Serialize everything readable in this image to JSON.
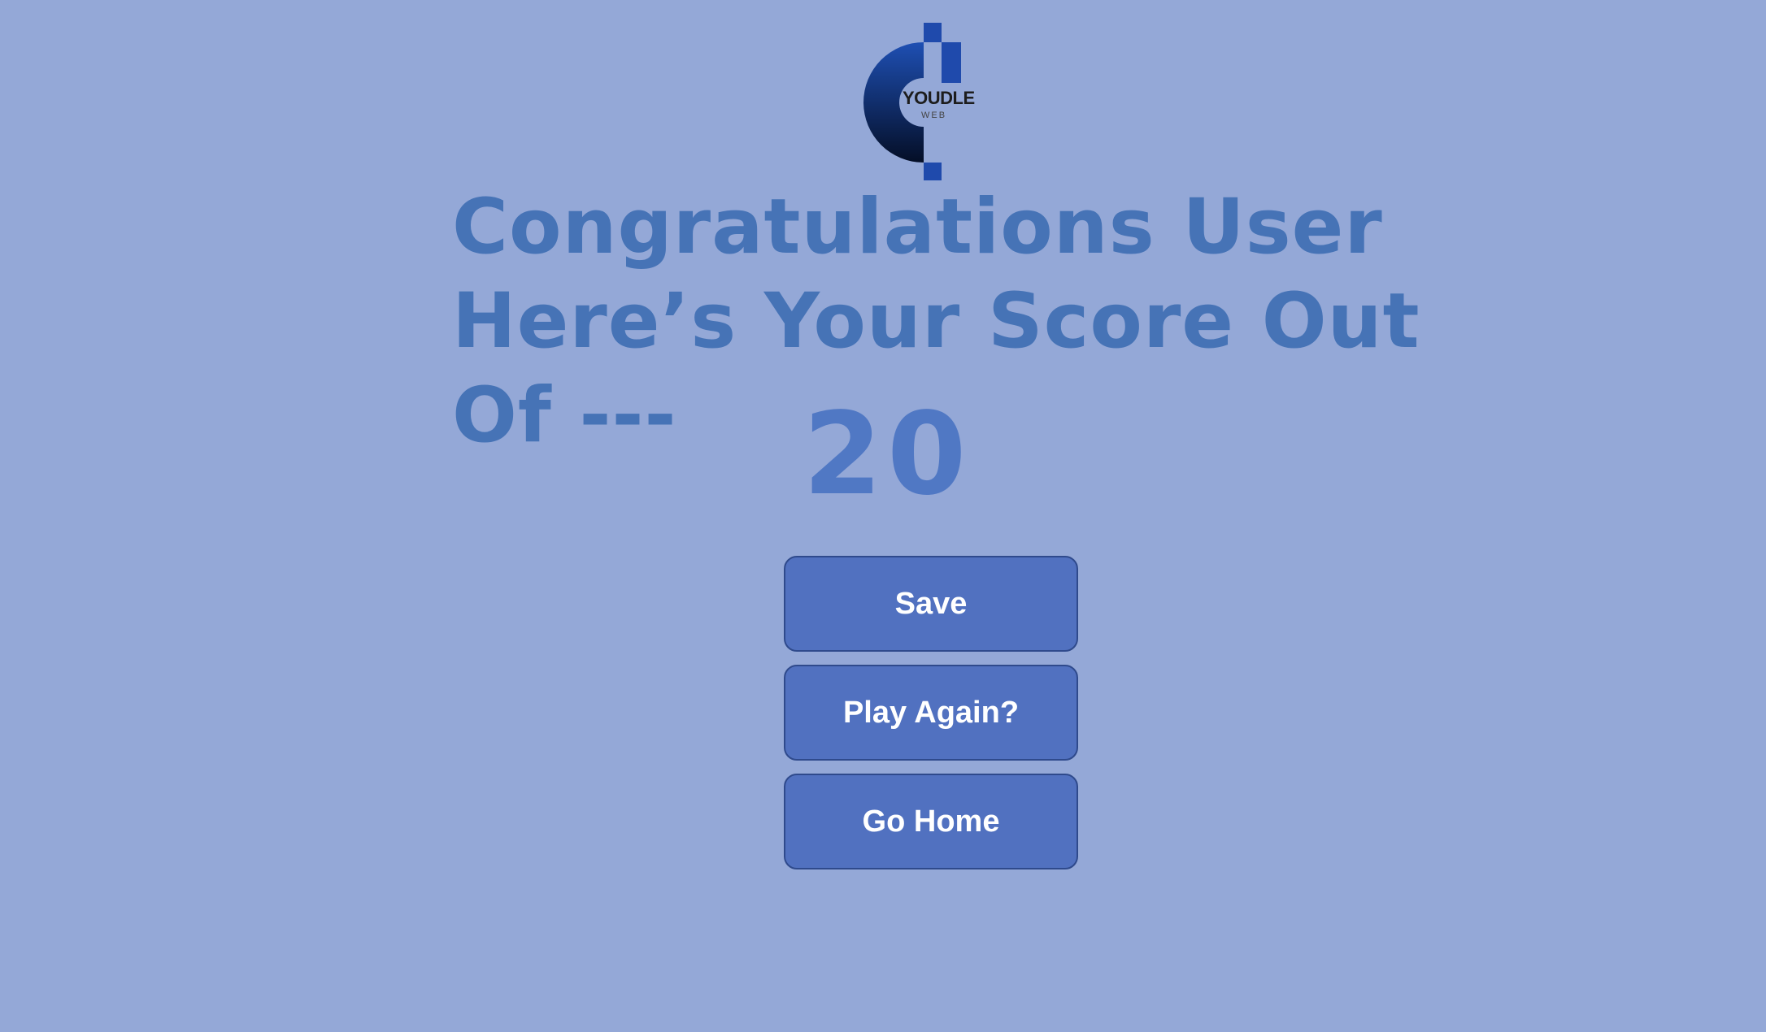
{
  "logo": {
    "name": "YOUDLE",
    "sub": "WEB"
  },
  "result": {
    "headline": "Congratulations User Here’s Your Score Out Of ---",
    "score": "20"
  },
  "actions": {
    "save_label": "Save",
    "play_again_label": "Play Again?",
    "go_home_label": "Go Home"
  },
  "colors": {
    "background": "#94a8d7",
    "headline": "#4673b6",
    "score": "#5078c4",
    "button": "#5171c0",
    "button_text": "#ffffff"
  }
}
